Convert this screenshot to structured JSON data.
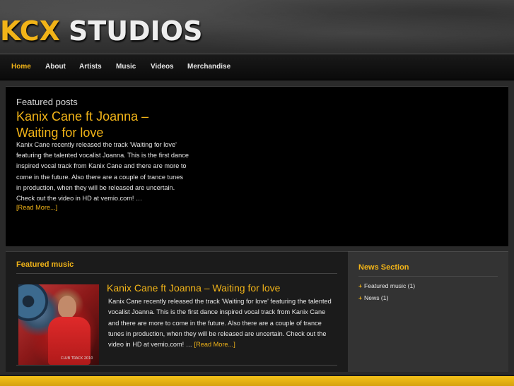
{
  "brand": {
    "logo_part1": "KCX",
    "logo_part2": "STUDIOS"
  },
  "nav": {
    "items": [
      {
        "label": "Home",
        "active": true
      },
      {
        "label": "About"
      },
      {
        "label": "Artists"
      },
      {
        "label": "Music"
      },
      {
        "label": "Videos"
      },
      {
        "label": "Merchandise"
      }
    ]
  },
  "featured_posts": {
    "label": "Featured posts",
    "title": "Kanix Cane ft Joanna – Waiting for love",
    "body": "Kanix Cane recently released the track 'Waiting for love' featuring the talented vocalist Joanna. This is the first dance inspired vocal track from Kanix Cane and there are more to come in the future. Also there are a couple of trance tunes in production, when they will be released are uncertain. Check out the video in HD at vemio.com! …",
    "read_more": "[Read More...]"
  },
  "featured_music": {
    "heading": "Featured music",
    "thumbnail_caption": "CLUB TRACK 2010",
    "title": "Kanix Cane ft Joanna – Waiting for love",
    "body": "Kanix Cane recently released the track 'Waiting for love' featuring the talented vocalist Joanna. This is the first dance inspired vocal track from Kanix Cane and there are more to come in the future. Also there are a couple of trance tunes in production, when they will be released are uncertain. Check out the video in HD at vemio.com! …",
    "read_more": "[Read More...]"
  },
  "news_section": {
    "heading": "News Section",
    "items": [
      {
        "label": "Featured music",
        "count": "(1)"
      },
      {
        "label": "News",
        "count": "(1)"
      }
    ]
  },
  "colors": {
    "accent": "#f2b418",
    "background": "#2a2a2a",
    "panel_black": "#000000"
  },
  "icons": {
    "bullet": "plus-bullet-icon"
  }
}
